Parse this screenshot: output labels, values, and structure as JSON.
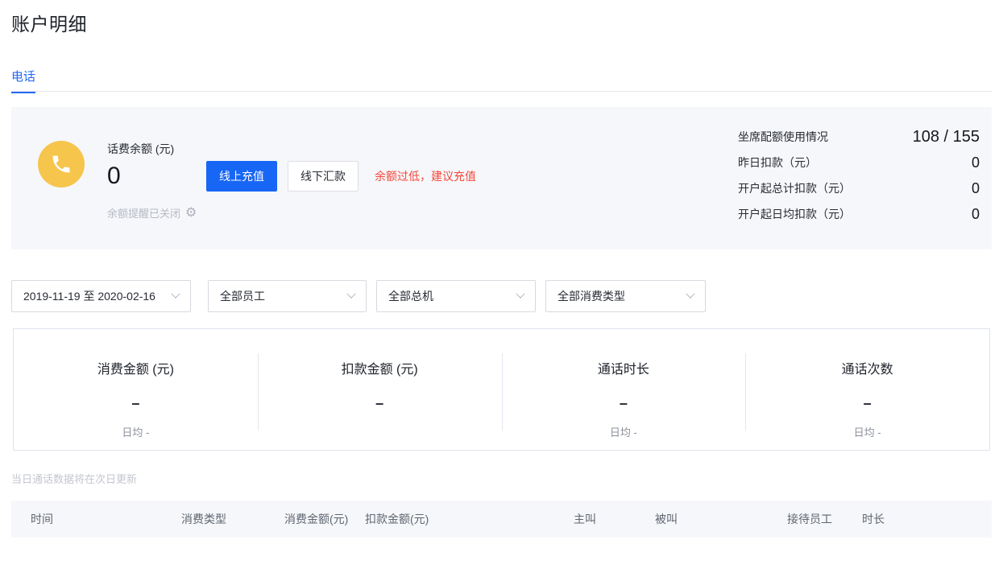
{
  "page": {
    "title": "账户明细"
  },
  "tabs": {
    "phone": "电话"
  },
  "balance_card": {
    "label": "话费余额 (元)",
    "value": "0",
    "recharge_online_label": "线上充值",
    "remit_offline_label": "线下汇款",
    "low_balance_warning": "余额过低，建议充值",
    "reminder_status": "余额提醒已关闭",
    "gear_glyph": "⚙",
    "stats": [
      {
        "label": "坐席配额使用情况",
        "value": "108 / 155"
      },
      {
        "label": "昨日扣款（元）",
        "value": "0"
      },
      {
        "label": "开户起总计扣款（元）",
        "value": "0"
      },
      {
        "label": "开户起日均扣款（元）",
        "value": "0"
      }
    ]
  },
  "filters": {
    "date_range": "2019-11-19 至 2020-02-16",
    "staff": "全部员工",
    "switchboard": "全部总机",
    "consume_type": "全部消费类型"
  },
  "summary_cards": [
    {
      "title": "消费金额 (元)",
      "value": "–",
      "sub": "日均 -"
    },
    {
      "title": "扣款金额 (元)",
      "value": "–",
      "sub": ""
    },
    {
      "title": "通话时长",
      "value": "–",
      "sub": "日均 -"
    },
    {
      "title": "通话次数",
      "value": "–",
      "sub": "日均 -"
    }
  ],
  "note": "当日通话数据将在次日更新",
  "table": {
    "columns": [
      "时间",
      "消费类型",
      "消费金额(元)",
      "扣款金额(元)",
      "主叫",
      "被叫",
      "接待员工",
      "时长"
    ]
  },
  "colors": {
    "accent_blue": "#2468f2",
    "button_blue": "#1766f6",
    "warning_red": "#f5483b",
    "icon_yellow": "#f6c54c",
    "card_bg": "#f6f7fa"
  }
}
